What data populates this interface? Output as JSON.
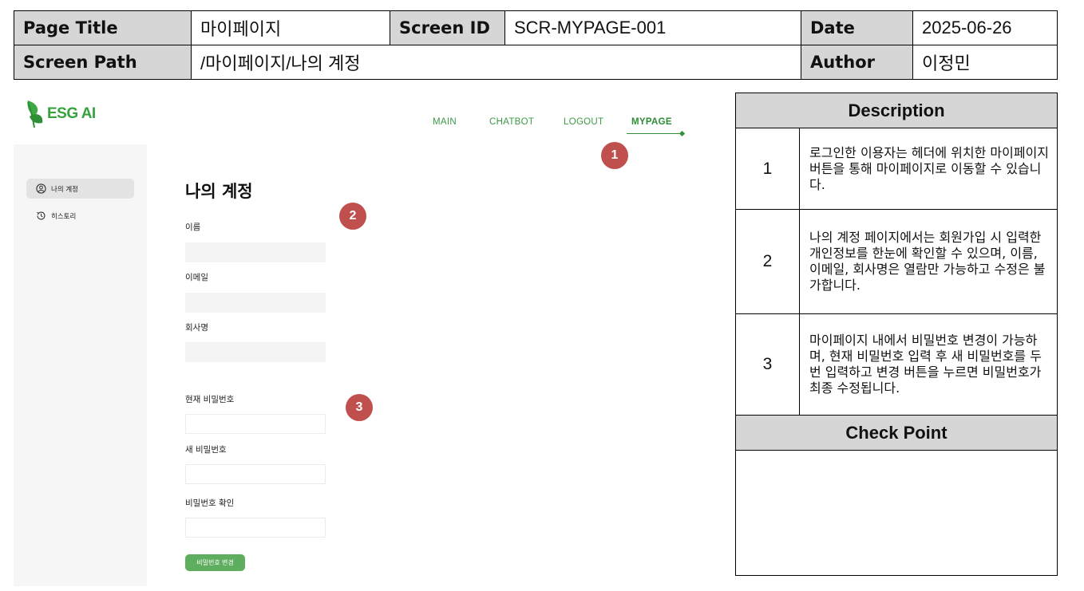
{
  "spec": {
    "page_title_label": "Page Title",
    "page_title_value": "마이페이지",
    "screen_id_label": "Screen ID",
    "screen_id_value": "SCR-MYPAGE-001",
    "date_label": "Date",
    "date_value": "2025-06-26",
    "screen_path_label": "Screen Path",
    "screen_path_value": "/마이페이지/나의 계정",
    "author_label": "Author",
    "author_value": "이정민"
  },
  "app": {
    "logo_text": "ESG AI",
    "brand_color": "#36a33e",
    "nav": [
      "MAIN",
      "CHATBOT",
      "LOGOUT",
      "MYPAGE"
    ],
    "active_nav": "MYPAGE"
  },
  "sidebar": {
    "items": [
      {
        "label": "나의 계정",
        "icon": "user-circle-icon",
        "active": true
      },
      {
        "label": "히스토리",
        "icon": "history-icon",
        "active": false
      }
    ]
  },
  "account": {
    "heading": "나의 계정",
    "fields": [
      {
        "label": "이름",
        "value": ""
      },
      {
        "label": "이메일",
        "value": ""
      },
      {
        "label": "회사명",
        "value": ""
      }
    ],
    "password_fields": [
      {
        "label": "현재 비밀번호",
        "value": ""
      },
      {
        "label": "새 비밀번호",
        "value": ""
      },
      {
        "label": "비밀번호 확인",
        "value": ""
      }
    ],
    "change_button": "비밀번호 변경"
  },
  "badges": [
    "1",
    "2",
    "3"
  ],
  "description": {
    "title": "Description",
    "rows": [
      {
        "num": "1",
        "text": "로그인한 이용자는 헤더에 위치한 마이페이지 버튼을 통해 마이페이지로 이동할 수 있습니다."
      },
      {
        "num": "2",
        "text": "나의 계정 페이지에서는 회원가입 시 입력한 개인정보를 한눈에 확인할 수 있으며, 이름, 이메일, 회사명은 열람만 가능하고 수정은 불가합니다."
      },
      {
        "num": "3",
        "text": "마이페이지 내에서 비밀번호 변경이 가능하며, 현재 비밀번호 입력 후 새 비밀번호를 두 번 입력하고 변경 버튼을 누르면 비밀번호가 최종 수정됩니다."
      }
    ],
    "checkpoint_title": "Check Point",
    "checkpoint_text": ""
  }
}
